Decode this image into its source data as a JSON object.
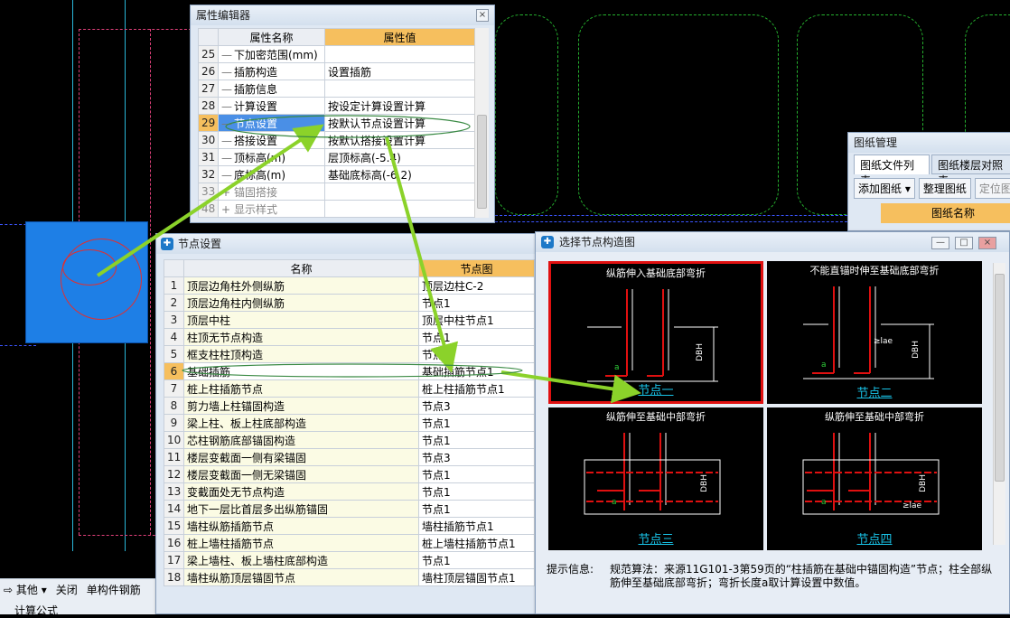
{
  "property_editor": {
    "title": "属性编辑器",
    "col_name": "属性名称",
    "col_value": "属性值",
    "rows": [
      {
        "idx": "25",
        "name": "下加密范围(mm)",
        "value": "",
        "tree": "dash"
      },
      {
        "idx": "26",
        "name": "插筋构造",
        "value": "设置插筋",
        "tree": "dash"
      },
      {
        "idx": "27",
        "name": "插筋信息",
        "value": "",
        "tree": "dash"
      },
      {
        "idx": "28",
        "name": "计算设置",
        "value": "按设定计算设置计算",
        "tree": "dash"
      },
      {
        "idx": "29",
        "name": "节点设置",
        "value": "按默认节点设置计算",
        "tree": "dash",
        "selected": true
      },
      {
        "idx": "30",
        "name": "搭接设置",
        "value": "按默认搭接设置计算",
        "tree": "dash"
      },
      {
        "idx": "31",
        "name": "顶标高(m)",
        "value": "层顶标高(-5.4)",
        "tree": "dash"
      },
      {
        "idx": "32",
        "name": "底标高(m)",
        "value": "基础底标高(-6.2)",
        "tree": "dash"
      },
      {
        "idx": "33",
        "name": "锚固搭接",
        "value": "",
        "tree": "plus",
        "gray": true
      },
      {
        "idx": "48",
        "name": "显示样式",
        "value": "",
        "tree": "plus",
        "gray": true
      }
    ]
  },
  "node_settings": {
    "title": "节点设置",
    "col_name": "名称",
    "col_node": "节点图",
    "rows": [
      {
        "idx": "1",
        "name": "顶层边角柱外侧纵筋",
        "node": "顶层边柱C-2"
      },
      {
        "idx": "2",
        "name": "顶层边角柱内侧纵筋",
        "node": "节点1"
      },
      {
        "idx": "3",
        "name": "顶层中柱",
        "node": "顶层中柱节点1"
      },
      {
        "idx": "4",
        "name": "柱顶无节点构造",
        "node": "节点1"
      },
      {
        "idx": "5",
        "name": "框支柱柱顶构造",
        "node": "节点1"
      },
      {
        "idx": "6",
        "name": "基础插筋",
        "node": "基础插筋节点1",
        "selected": true
      },
      {
        "idx": "7",
        "name": "桩上柱插筋节点",
        "node": "桩上柱插筋节点1"
      },
      {
        "idx": "8",
        "name": "剪力墙上柱锚固构造",
        "node": "节点3"
      },
      {
        "idx": "9",
        "name": "梁上柱、板上柱底部构造",
        "node": "节点1"
      },
      {
        "idx": "10",
        "name": "芯柱钢筋底部锚固构造",
        "node": "节点1"
      },
      {
        "idx": "11",
        "name": "楼层变截面一侧有梁锚固",
        "node": "节点3"
      },
      {
        "idx": "12",
        "name": "楼层变截面一侧无梁锚固",
        "node": "节点1"
      },
      {
        "idx": "13",
        "name": "变截面处无节点构造",
        "node": "节点1"
      },
      {
        "idx": "14",
        "name": "地下一层比首层多出纵筋锚固",
        "node": "节点1"
      },
      {
        "idx": "15",
        "name": "墙柱纵筋插筋节点",
        "node": "墙柱插筋节点1"
      },
      {
        "idx": "16",
        "name": "桩上墙柱插筋节点",
        "node": "桩上墙柱插筋节点1"
      },
      {
        "idx": "17",
        "name": "梁上墙柱、板上墙柱底部构造",
        "node": "节点1"
      },
      {
        "idx": "18",
        "name": "墙柱纵筋顶层锚固节点",
        "node": "墙柱顶层锚固节点1"
      }
    ]
  },
  "select_node": {
    "title": "选择节点构造图",
    "cells": [
      {
        "title": "纵筋伸入基础底部弯折",
        "label": "节点一",
        "selected": true,
        "dim": "DBH",
        "mark": "a"
      },
      {
        "title": "不能直锚时伸至基础底部弯折",
        "label": "节点二",
        "dim": "DBH",
        "mark": "a",
        "extra": "≥lae"
      },
      {
        "title": "纵筋伸至基础中部弯折",
        "label": "节点三",
        "dim": "DBH",
        "mark": "a"
      },
      {
        "title": "纵筋伸至基础中部弯折",
        "label": "节点四",
        "dim": "DBH",
        "mark": "a",
        "extra": "≥lae"
      }
    ],
    "hint_label": "提示信息:",
    "hint_text": "规范算法：来源11G101-3第59页的“柱插筋在基础中锚固构造”节点；柱全部纵筋伸至基础底部弯折；弯折长度a取计算设置中数值。"
  },
  "drawing_mgr": {
    "title": "图纸管理",
    "tab1": "图纸文件列表",
    "tab2": "图纸楼层对照表",
    "btn_add": "添加图纸",
    "btn_arrange": "整理图纸",
    "btn_locate": "定位图",
    "col_name": "图纸名称"
  },
  "bottom_toolbar": {
    "other": "其他",
    "close": "关闭",
    "single": "单构件钢筋",
    "formula": "计算公式"
  },
  "colors": {
    "accent_orange": "#f6bf5e",
    "selection_blue": "#4a8fe6",
    "node_label": "#19c3e8",
    "annotation_green": "#8bd22a"
  }
}
